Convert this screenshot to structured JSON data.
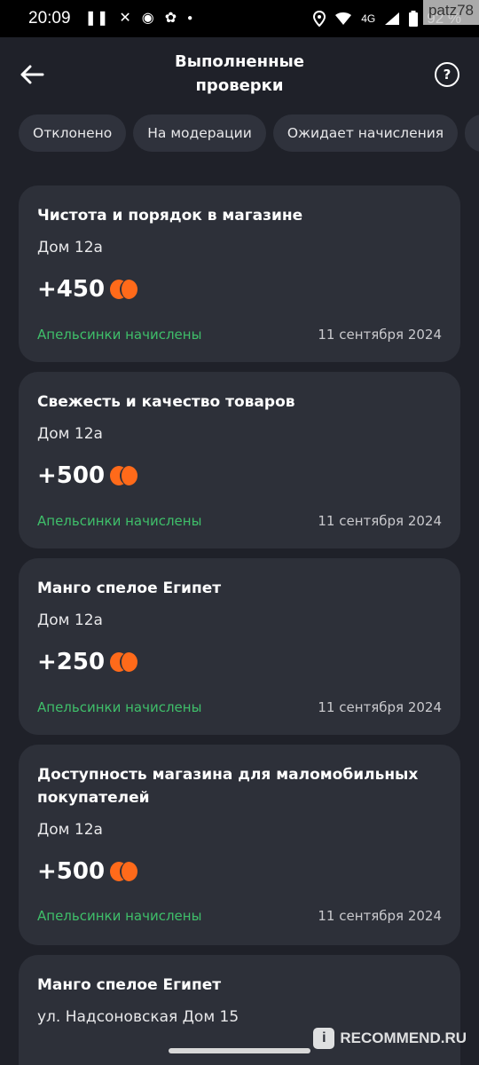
{
  "status_bar": {
    "time": "20:09",
    "network": "4G",
    "battery": "92 %",
    "icons": [
      "pause-icon",
      "cutlery-icon",
      "accessibility-icon",
      "bird-icon",
      "dot-icon",
      "location-icon",
      "wifi-icon",
      "signal-icon",
      "battery-icon"
    ]
  },
  "watermark_top": "patz78",
  "header": {
    "title_line1": "Выполненные",
    "title_line2": "проверки",
    "back_icon": "arrow-left-icon",
    "help_icon": "question-circle-icon",
    "help_glyph": "?"
  },
  "filters": [
    {
      "label": "Отклонено"
    },
    {
      "label": "На модерации"
    },
    {
      "label": "Ожидает начисления"
    },
    {
      "label": ""
    }
  ],
  "colors": {
    "background": "#1f2129",
    "card": "#2d3039",
    "chip": "#2f323c",
    "accent_orange": "#ff6a1a",
    "status_green": "#3fbf6a"
  },
  "cards": [
    {
      "title": "Чистота и порядок в магазине",
      "address": "Дом 12а",
      "points": "+450",
      "status": "Апельсинки начислены",
      "date": "11 сентября 2024"
    },
    {
      "title": "Свежесть и качество товаров",
      "address": "Дом 12а",
      "points": "+500",
      "status": "Апельсинки начислены",
      "date": "11 сентября 2024"
    },
    {
      "title": "Манго спелое Египет",
      "address": "Дом 12а",
      "points": "+250",
      "status": "Апельсинки начислены",
      "date": "11 сентября 2024"
    },
    {
      "title": "Доступность магазина для маломобильных покупателей",
      "address": "Дом 12а",
      "points": "+500",
      "status": "Апельсинки начислены",
      "date": "11 сентября 2024"
    },
    {
      "title": "Манго спелое Египет",
      "address": "ул. Надсоновская Дом 15",
      "points": "",
      "status": "",
      "date": ""
    }
  ],
  "watermark_bottom": {
    "badge": "i",
    "text": "RECOMMEND.RU"
  }
}
